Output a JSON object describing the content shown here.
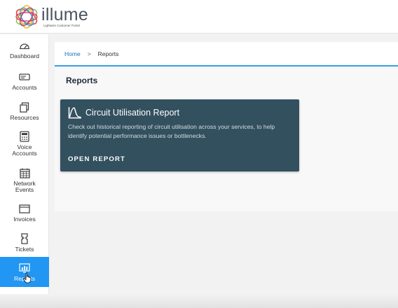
{
  "header": {
    "brand_name": "illume",
    "brand_tagline": "Lightwire Customer Portal"
  },
  "sidebar": {
    "items": [
      {
        "label": "Dashboard",
        "icon": "gauge-icon"
      },
      {
        "label": "Accounts",
        "icon": "accounts-icon"
      },
      {
        "label": "Resources",
        "icon": "resources-icon"
      },
      {
        "label": "Voice Accounts",
        "icon": "phone-icon"
      },
      {
        "label": "Network Events",
        "icon": "calendar-icon"
      },
      {
        "label": "Invoices",
        "icon": "invoice-icon"
      },
      {
        "label": "Tickets",
        "icon": "ticket-icon"
      },
      {
        "label": "Reports",
        "icon": "reports-icon",
        "active": true
      }
    ]
  },
  "breadcrumb": {
    "home": "Home",
    "separator": ">",
    "current": "Reports"
  },
  "page": {
    "title": "Reports"
  },
  "report_card": {
    "title": "Circuit Utilisation Report",
    "description": "Check out historical reporting of circuit utilisation across your services, to help identify potential performance issues or bottlenecks.",
    "action": "OPEN REPORT",
    "icon": "chart-curve-icon"
  },
  "colors": {
    "active_nav": "#2196f3",
    "card_bg": "#33505f",
    "breadcrumb_underline": "#3aa0e6"
  }
}
